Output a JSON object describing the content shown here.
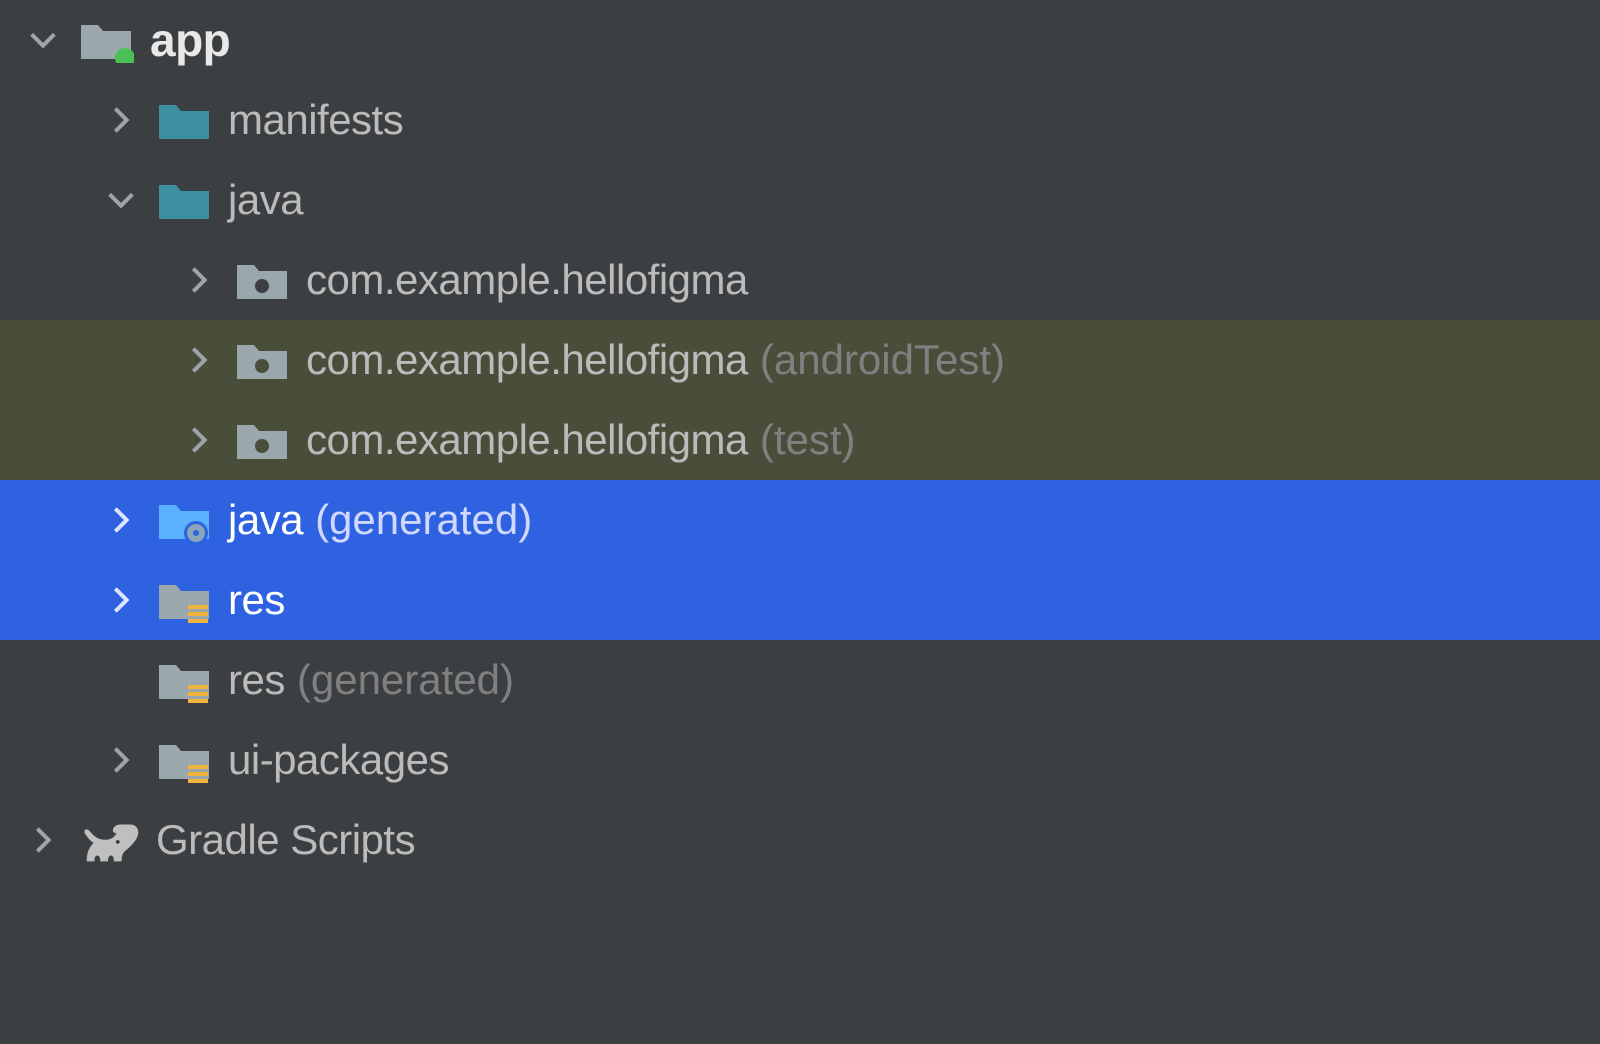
{
  "tree": {
    "app": {
      "label": "app"
    },
    "manifests": {
      "label": "manifests"
    },
    "java": {
      "label": "java"
    },
    "pkg_main": {
      "label": "com.example.hellofigma"
    },
    "pkg_android_test": {
      "label": "com.example.hellofigma",
      "suffix": "(androidTest)"
    },
    "pkg_test": {
      "label": "com.example.hellofigma",
      "suffix": "(test)"
    },
    "java_generated": {
      "label": "java",
      "suffix": "(generated)"
    },
    "res": {
      "label": "res"
    },
    "res_generated": {
      "label": "res",
      "suffix": "(generated)"
    },
    "ui_packages": {
      "label": "ui-packages"
    },
    "gradle_scripts": {
      "label": "Gradle Scripts"
    }
  }
}
